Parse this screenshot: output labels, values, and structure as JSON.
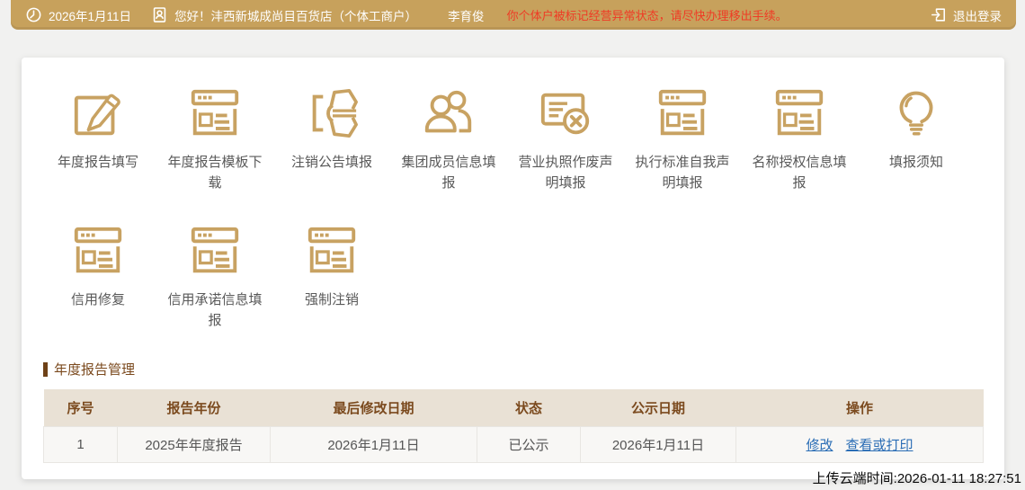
{
  "topbar": {
    "date": "2026年1月11日",
    "greeting": "您好！沣西新城成尚目百货店（个体工商户）",
    "username": "李育俊",
    "warning": "你个体户被标记经营异常状态，请尽快办理移出手续。",
    "logout_label": "退出登录"
  },
  "grid": {
    "items": [
      {
        "label": "年度报告填写",
        "icon": "edit-box-icon"
      },
      {
        "label": "年度报告模板下载",
        "icon": "browser-doc-icon"
      },
      {
        "label": "注销公告填报",
        "icon": "page-flip-icon"
      },
      {
        "label": "集团成员信息填报",
        "icon": "group-members-icon"
      },
      {
        "label": "营业执照作废声明填报",
        "icon": "doc-cancel-icon"
      },
      {
        "label": "执行标准自我声明填报",
        "icon": "browser-doc-icon"
      },
      {
        "label": "名称授权信息填报",
        "icon": "browser-doc-icon"
      },
      {
        "label": "填报须知",
        "icon": "lightbulb-icon"
      },
      {
        "label": "信用修复",
        "icon": "browser-doc-icon"
      },
      {
        "label": "信用承诺信息填报",
        "icon": "browser-doc-icon"
      },
      {
        "label": "强制注销",
        "icon": "browser-doc-icon"
      }
    ]
  },
  "section": {
    "title": "年度报告管理"
  },
  "table": {
    "headers": [
      "序号",
      "报告年份",
      "最后修改日期",
      "状态",
      "公示日期",
      "操作"
    ],
    "rows": [
      {
        "cells": [
          "1",
          "2025年年度报告",
          "2026年1月11日",
          "已公示",
          "2026年1月11日"
        ],
        "actions": [
          "修改",
          "查看或打印"
        ]
      }
    ]
  },
  "footer": {
    "upload_time": "上传云端时间:2026-01-11 18:27:51"
  },
  "colors": {
    "topbar_bg": "#c7a15c",
    "icon_gold": "#c8a262",
    "warning_red": "#ef3b25",
    "table_header_bg": "#e9e1d5",
    "table_header_text": "#7b4a1e",
    "link_blue": "#2a6db5"
  }
}
